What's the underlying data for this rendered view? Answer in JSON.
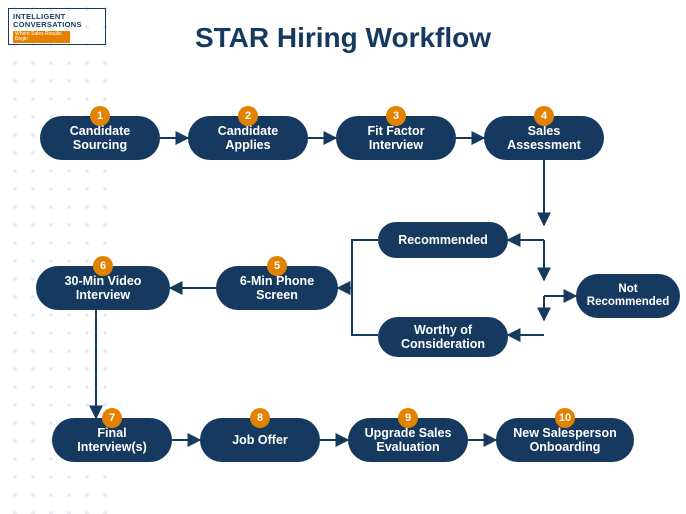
{
  "brand": {
    "line1": "INTELLIGENT",
    "line2": "CONVERSATIONS",
    "tagline": "Where Sales Results Begin"
  },
  "title": "STAR Hiring Workflow",
  "colors": {
    "primary": "#163a5f",
    "accent": "#e38200"
  },
  "nodes": {
    "n1": {
      "num": "1",
      "label": "Candidate Sourcing"
    },
    "n2": {
      "num": "2",
      "label": "Candidate Applies"
    },
    "n3": {
      "num": "3",
      "label": "Fit Factor Interview"
    },
    "n4": {
      "num": "4",
      "label": "Sales Assessment"
    },
    "rec": {
      "label": "Recommended"
    },
    "not": {
      "label": "Not Recommended"
    },
    "woc": {
      "label": "Worthy of Consideration"
    },
    "n5": {
      "num": "5",
      "label": "6-Min Phone Screen"
    },
    "n6": {
      "num": "6",
      "label": "30-Min Video Interview"
    },
    "n7": {
      "num": "7",
      "label": "Final Interview(s)"
    },
    "n8": {
      "num": "8",
      "label": "Job Offer"
    },
    "n9": {
      "num": "9",
      "label": "Upgrade Sales Evaluation"
    },
    "n10": {
      "num": "10",
      "label": "New Salesperson Onboarding"
    }
  },
  "edges": [
    [
      "n1",
      "n2"
    ],
    [
      "n2",
      "n3"
    ],
    [
      "n3",
      "n4"
    ],
    [
      "n4",
      "rec"
    ],
    [
      "n4",
      "woc"
    ],
    [
      "n4",
      "not"
    ],
    [
      "rec",
      "n5"
    ],
    [
      "woc",
      "n5"
    ],
    [
      "n5",
      "n6"
    ],
    [
      "n6",
      "n7"
    ],
    [
      "n7",
      "n8"
    ],
    [
      "n8",
      "n9"
    ],
    [
      "n9",
      "n10"
    ]
  ]
}
